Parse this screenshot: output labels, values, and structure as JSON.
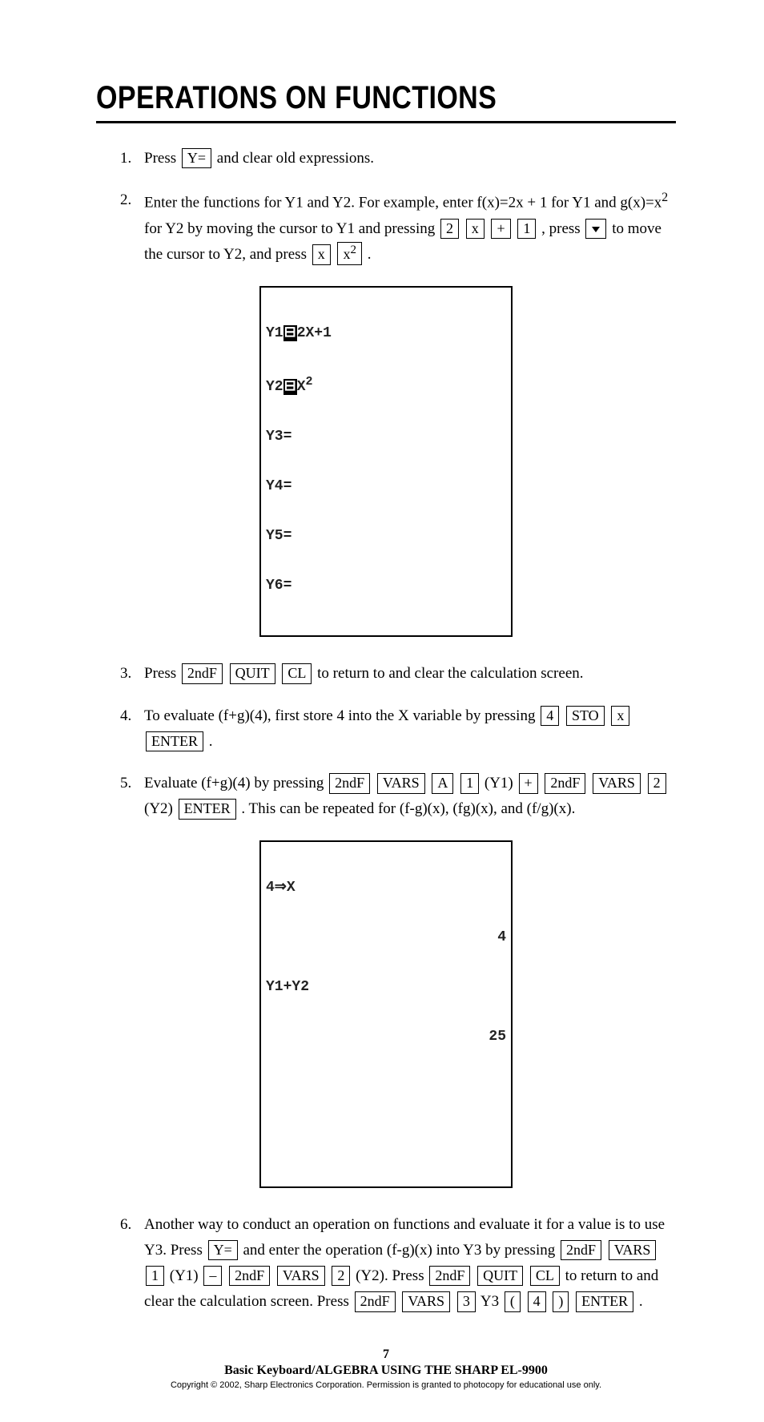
{
  "title": "OPERATIONS ON FUNCTIONS",
  "steps": {
    "s1": {
      "num": "1.",
      "t1": "Press ",
      "k1": "Y=",
      "t2": " and clear old expressions."
    },
    "s2": {
      "num": "2.",
      "t1": "Enter the functions for Y1 and Y2.  For example, enter f(x)=2x + 1 for Y1 and g(x)=x",
      "sup1": "2",
      "t2": " for Y2 by moving the cursor to Y1 and pressing ",
      "k1": "2",
      "k2": "x",
      "k3": "+",
      "k4": "1",
      "t3": " , press ",
      "t4": " to move the cursor to Y2, and press ",
      "k5": "x",
      "k6a": "x",
      "k6b": "2",
      "t5": " ."
    },
    "s3": {
      "num": "3.",
      "t1": "Press ",
      "k1": "2ndF",
      "k2": "QUIT",
      "k3": "CL",
      "t2": " to return to and clear the calculation screen."
    },
    "s4": {
      "num": "4.",
      "t1": "To evaluate (f+g)(4), first store 4 into the X variable by pressing ",
      "k1": "4",
      "k2": "STO",
      "k3": "x",
      "k4": "ENTER",
      "t2": " ."
    },
    "s5": {
      "num": "5.",
      "t1": "Evaluate (f+g)(4) by pressing ",
      "k1": "2ndF",
      "k2": "VARS",
      "k3": "A",
      "k4": "1",
      "t2": " (Y1) ",
      "k5": "+",
      "k6": "2ndF",
      "k7": "VARS",
      "k8": "2",
      "t3": " (Y2) ",
      "k9": "ENTER",
      "t4": " .  This can be repeated for (f-g)(x), (fg)(x), and (f/g)(x)."
    },
    "s6": {
      "num": "6.",
      "t1": "Another way to conduct an operation on functions and evaluate it for a value is to use Y3.  Press ",
      "k1": "Y=",
      "t2": " and enter the operation (f-g)(x) into Y3 by pressing ",
      "k2": "2ndF",
      "k3": "VARS",
      "k4": "1",
      "t3": " (Y1) ",
      "k5": "–",
      "k6": "2ndF",
      "k7": "VARS",
      "k8": "2",
      "t4": " (Y2).  Press ",
      "k9": "2ndF",
      "k10": "QUIT",
      "k11": "CL",
      "t5": " to return to and clear the calculation screen.  Press ",
      "k12": "2ndF",
      "k13": "VARS",
      "k14": "3",
      "t6": " Y3 ",
      "k15": "(",
      "k16": "4",
      "k17": ")",
      "k18": "ENTER",
      "t7": " ."
    }
  },
  "screen1": {
    "l1a": "Y1",
    "l1b": "2X+1",
    "l2a": "Y2",
    "l2b": "X",
    "l3": "Y3=",
    "l4": "Y4=",
    "l5": "Y5=",
    "l6": "Y6="
  },
  "screen2": {
    "l1": "4⇒X",
    "r1": "4",
    "l2": "Y1+Y2",
    "r2": "25"
  },
  "footer": {
    "page": "7",
    "book": "Basic Keyboard/ALGEBRA USING THE SHARP EL-9900",
    "copyright": "Copyright © 2002, Sharp Electronics Corporation.  Permission is granted to photocopy for educational use only."
  }
}
